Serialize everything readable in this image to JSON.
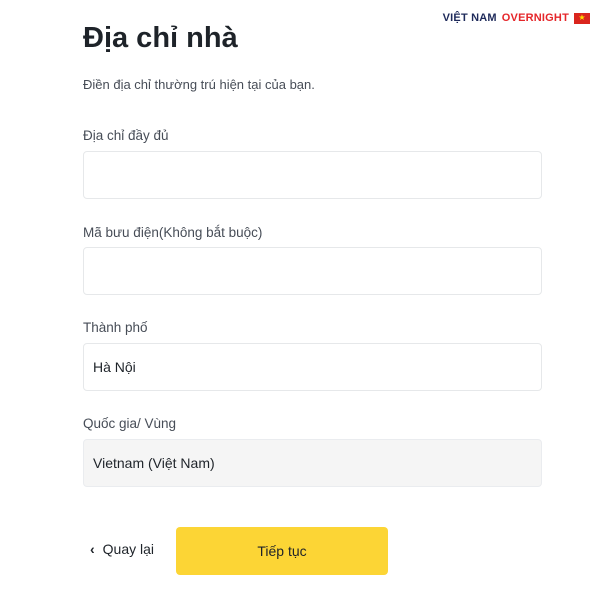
{
  "brand": {
    "part1": "VIỆT NAM",
    "part2": "OVERNIGHT",
    "flag_icon": "vietnam-flag-icon",
    "flag_star": "★"
  },
  "header": {
    "title": "Địa chỉ nhà",
    "subtitle": "Điền địa chỉ thường trú hiện tại của bạn."
  },
  "form": {
    "address": {
      "label": "Địa chỉ đầy đủ",
      "value": ""
    },
    "postal": {
      "label": "Mã bưu điện(Không bắt buộc)",
      "value": ""
    },
    "city": {
      "label": "Thành phố",
      "value": "Hà Nội"
    },
    "country": {
      "label": "Quốc gia/ Vùng",
      "value": "Vietnam (Việt Nam)"
    }
  },
  "actions": {
    "back_label": "Quay lại",
    "back_icon": "chevron-left-icon",
    "next_label": "Tiếp tục"
  },
  "colors": {
    "primary_button": "#fcd535",
    "brand_navy": "#1e2a5a",
    "brand_red": "#e5262a"
  }
}
